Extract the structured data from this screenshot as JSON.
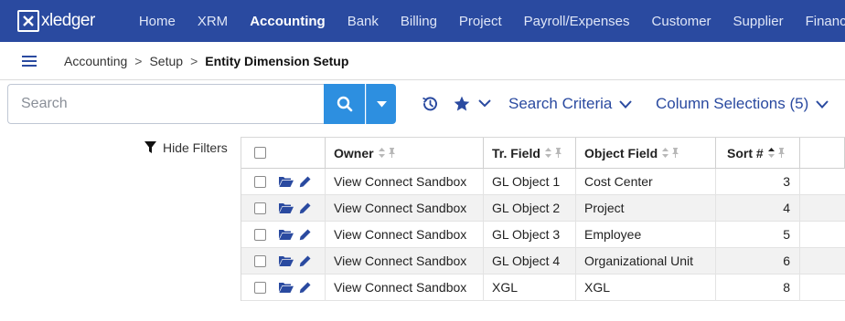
{
  "nav": {
    "logo_text": "xledger",
    "items": [
      {
        "label": "Home",
        "active": false
      },
      {
        "label": "XRM",
        "active": false
      },
      {
        "label": "Accounting",
        "active": true
      },
      {
        "label": "Bank",
        "active": false
      },
      {
        "label": "Billing",
        "active": false
      },
      {
        "label": "Project",
        "active": false
      },
      {
        "label": "Payroll/Expenses",
        "active": false
      },
      {
        "label": "Customer",
        "active": false
      },
      {
        "label": "Supplier",
        "active": false
      },
      {
        "label": "Financia",
        "active": false
      }
    ],
    "colors": {
      "bar": "#2a4aa0",
      "accent": "#2d8fe0"
    }
  },
  "breadcrumb": {
    "items": [
      "Accounting",
      "Setup"
    ],
    "separator": ">",
    "current": "Entity Dimension Setup"
  },
  "search": {
    "placeholder": "Search",
    "value": "",
    "criteria_label": "Search Criteria",
    "column_selections_label": "Column Selections (5)"
  },
  "filters": {
    "hide_label": "Hide Filters"
  },
  "table": {
    "columns": [
      "Owner",
      "Tr. Field",
      "Object Field",
      "Sort #"
    ],
    "rows": [
      {
        "owner": "View Connect Sandbox",
        "tr_field": "GL Object 1",
        "object_field": "Cost Center",
        "sort": "3"
      },
      {
        "owner": "View Connect Sandbox",
        "tr_field": "GL Object 2",
        "object_field": "Project",
        "sort": "4"
      },
      {
        "owner": "View Connect Sandbox",
        "tr_field": "GL Object 3",
        "object_field": "Employee",
        "sort": "5"
      },
      {
        "owner": "View Connect Sandbox",
        "tr_field": "GL Object 4",
        "object_field": "Organizational Unit",
        "sort": "6"
      },
      {
        "owner": "View Connect Sandbox",
        "tr_field": "XGL",
        "object_field": "XGL",
        "sort": "8"
      }
    ]
  }
}
